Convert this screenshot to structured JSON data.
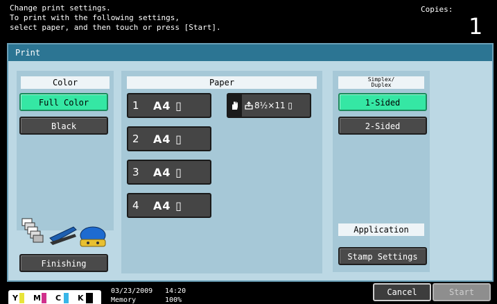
{
  "header": {
    "message": "Change print settings.\nTo print with the following settings,\nselect paper, and then touch or press [Start].",
    "copies_label": "Copies:",
    "copies_value": "1"
  },
  "panel": {
    "title": "Print"
  },
  "color": {
    "label": "Color",
    "options": [
      "Full Color",
      "Black"
    ],
    "selected": "Full Color"
  },
  "paper": {
    "label": "Paper",
    "trays": [
      {
        "number": "1",
        "size": "A4 ▯"
      },
      {
        "number": "2",
        "size": "A4 ▯"
      },
      {
        "number": "3",
        "size": "A4 ▯"
      },
      {
        "number": "4",
        "size": "A4 ▯"
      }
    ],
    "bypass": {
      "size": "8½×11 ▯"
    }
  },
  "duplex": {
    "label_line1": "Simplex/",
    "label_line2": "Duplex",
    "options": [
      "1-Sided",
      "2-Sided"
    ],
    "selected": "1-Sided"
  },
  "finishing": {
    "button": "Finishing"
  },
  "application": {
    "label": "Application",
    "button": "Stamp Settings"
  },
  "footer": {
    "toner": [
      "Y",
      "M",
      "C",
      "K"
    ],
    "date": "03/23/2009",
    "time": "14:20",
    "memory_label": "Memory",
    "memory_value": "100%",
    "cancel": "Cancel",
    "start": "Start"
  },
  "colors": {
    "selected_green": "#35e7a4",
    "title_bar": "#2c7593",
    "panel_bg": "#bcd8e4",
    "toner_yellow": "#e8e43a",
    "toner_magenta": "#d0308c",
    "toner_cyan": "#38b6e8",
    "toner_black": "#000000"
  }
}
